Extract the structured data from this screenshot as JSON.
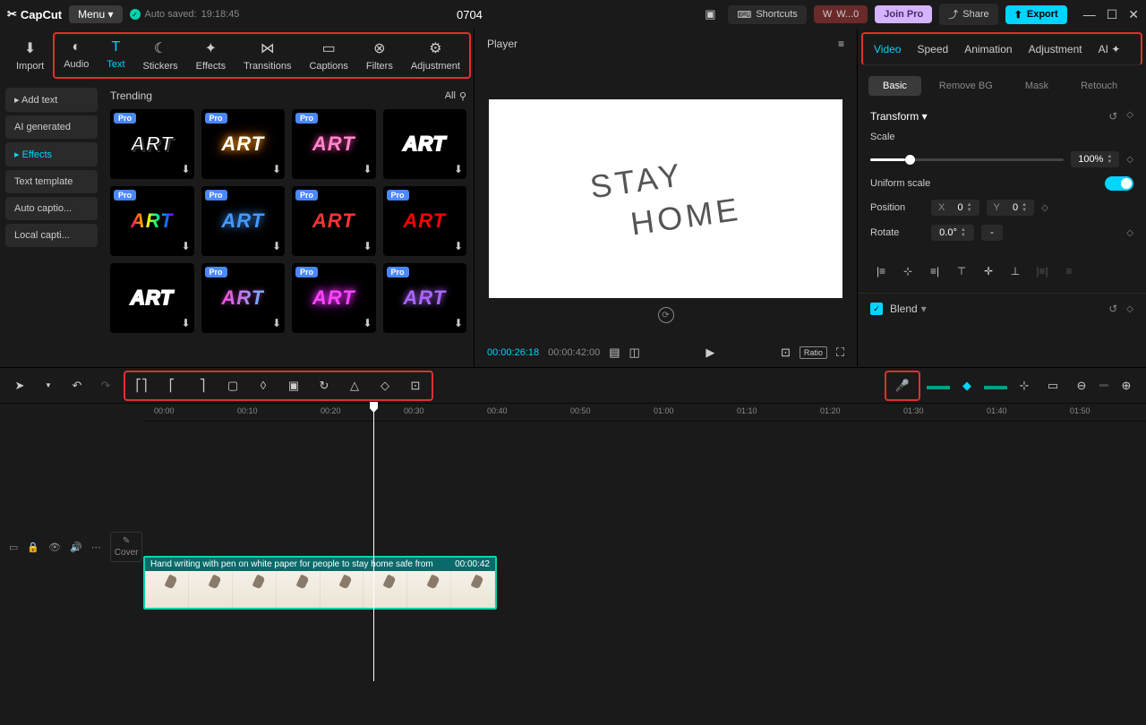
{
  "titlebar": {
    "logo": "CapCut",
    "menu": "Menu",
    "autosave_label": "Auto saved:",
    "autosave_time": "19:18:45",
    "project_title": "0704",
    "shortcuts": "Shortcuts",
    "workspace": "W...0",
    "join_pro": "Join Pro",
    "share": "Share",
    "export": "Export"
  },
  "top_tabs": {
    "import": "Import",
    "audio": "Audio",
    "text": "Text",
    "stickers": "Stickers",
    "effects": "Effects",
    "transitions": "Transitions",
    "captions": "Captions",
    "filters": "Filters",
    "adjustment": "Adjustment"
  },
  "side_nav": {
    "add_text": "Add text",
    "ai_generated": "AI generated",
    "effects": "Effects",
    "text_template": "Text template",
    "auto_captions": "Auto captio...",
    "local_captions": "Local capti..."
  },
  "grid": {
    "heading": "Trending",
    "filter": "All",
    "art_label": "ART",
    "pro": "Pro"
  },
  "player": {
    "title": "Player",
    "preview_text_1": "STAY",
    "preview_text_2": "HOME",
    "time_current": "00:00:26:18",
    "time_total": "00:00:42:00",
    "ratio": "Ratio"
  },
  "inspector": {
    "tabs": {
      "video": "Video",
      "speed": "Speed",
      "animation": "Animation",
      "adjustment": "Adjustment",
      "ai": "AI"
    },
    "subtabs": {
      "basic": "Basic",
      "remove_bg": "Remove BG",
      "mask": "Mask",
      "retouch": "Retouch"
    },
    "transform": "Transform",
    "scale": "Scale",
    "scale_value": "100%",
    "uniform_scale": "Uniform scale",
    "position": "Position",
    "pos_x_label": "X",
    "pos_x": "0",
    "pos_y_label": "Y",
    "pos_y": "0",
    "rotate": "Rotate",
    "rotate_value": "0.0°",
    "blend": "Blend"
  },
  "timeline": {
    "ticks": [
      "00:00",
      "00:10",
      "00:20",
      "00:30",
      "00:40",
      "00:50",
      "01:00",
      "01:10",
      "01:20",
      "01:30",
      "01:40",
      "01:50"
    ],
    "cover": "Cover",
    "clip_title": "Hand writing with pen on white paper for people to stay home safe from",
    "clip_duration": "00:00:42"
  }
}
